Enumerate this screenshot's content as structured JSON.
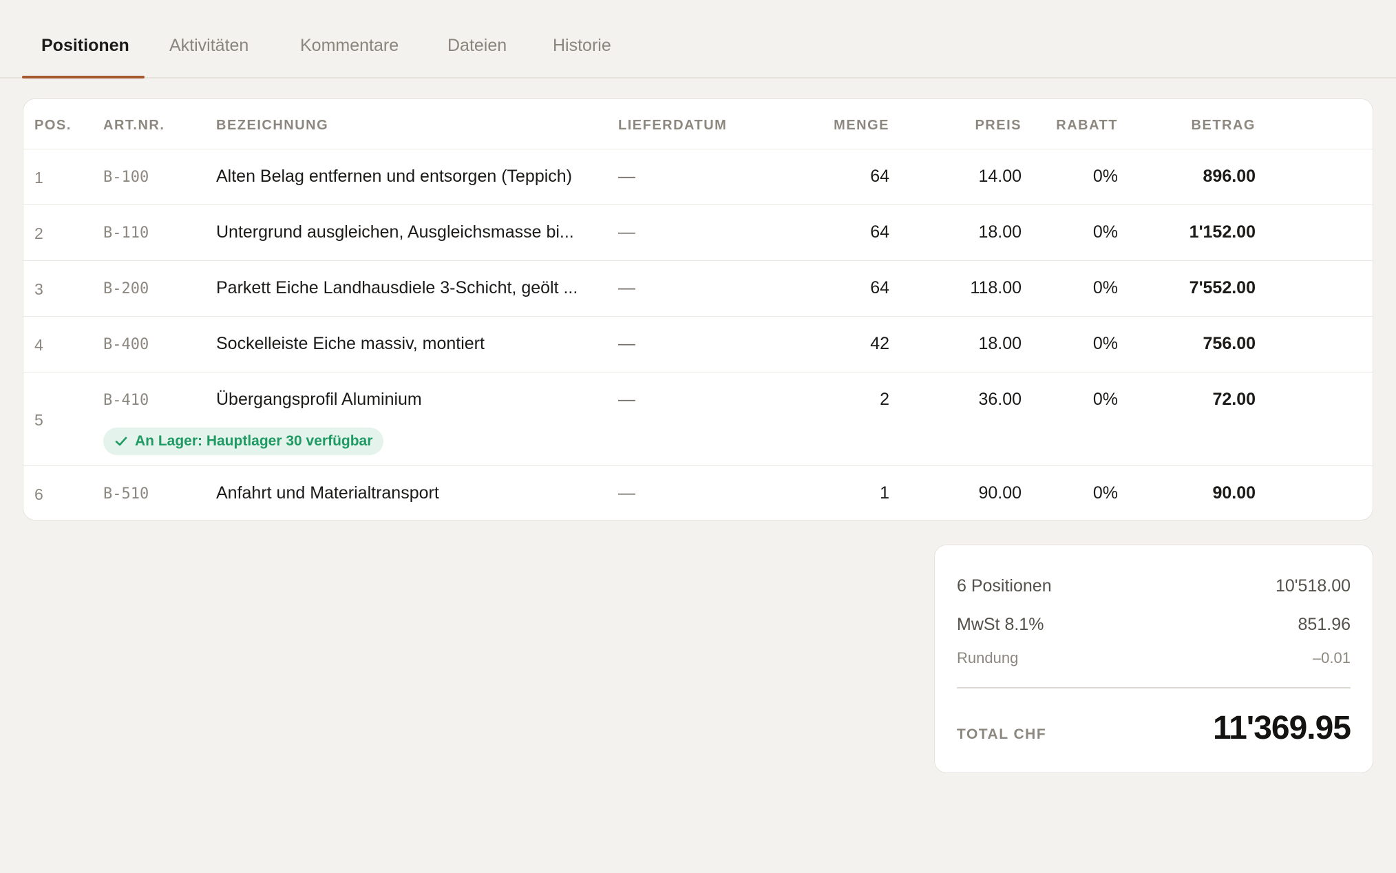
{
  "tabs": [
    {
      "label": "Positionen",
      "active": true
    },
    {
      "label": "Aktivitäten",
      "active": false
    },
    {
      "label": "Kommentare",
      "active": false
    },
    {
      "label": "Dateien",
      "active": false
    },
    {
      "label": "Historie",
      "active": false
    }
  ],
  "table": {
    "headers": {
      "pos": "POS.",
      "art": "ART.NR.",
      "desc": "BEZEICHNUNG",
      "date": "LIEFERDATUM",
      "qty": "MENGE",
      "price": "PREIS",
      "discount": "RABATT",
      "amount": "BETRAG"
    },
    "rows": [
      {
        "pos": "1",
        "art": "B-100",
        "desc": "Alten Belag entfernen und entsorgen (Teppich)",
        "date": "—",
        "qty": "64",
        "price": "14.00",
        "discount": "0%",
        "amount": "896.00"
      },
      {
        "pos": "2",
        "art": "B-110",
        "desc": "Untergrund ausgleichen, Ausgleichsmasse bi...",
        "date": "—",
        "qty": "64",
        "price": "18.00",
        "discount": "0%",
        "amount": "1'152.00"
      },
      {
        "pos": "3",
        "art": "B-200",
        "desc": "Parkett Eiche Landhausdiele 3-Schicht, geölt ...",
        "date": "—",
        "qty": "64",
        "price": "118.00",
        "discount": "0%",
        "amount": "7'552.00"
      },
      {
        "pos": "4",
        "art": "B-400",
        "desc": "Sockelleiste Eiche massiv, montiert",
        "date": "—",
        "qty": "42",
        "price": "18.00",
        "discount": "0%",
        "amount": "756.00"
      },
      {
        "pos": "5",
        "art": "B-410",
        "desc": "Übergangsprofil Aluminium",
        "date": "—",
        "qty": "2",
        "price": "36.00",
        "discount": "0%",
        "amount": "72.00",
        "badge": "An Lager: Hauptlager 30 verfügbar"
      },
      {
        "pos": "6",
        "art": "B-510",
        "desc": "Anfahrt und Materialtransport",
        "date": "—",
        "qty": "1",
        "price": "90.00",
        "discount": "0%",
        "amount": "90.00"
      }
    ]
  },
  "summary": {
    "positions_label": "6 Positionen",
    "positions_value": "10'518.00",
    "vat_label": "MwSt 8.1%",
    "vat_value": "851.96",
    "rounding_label": "Rundung",
    "rounding_value": "–0.01",
    "total_label": "TOTAL CHF",
    "total_value": "11'369.95"
  },
  "colors": {
    "accent": "#a8582f",
    "stock_green": "#1f9a63",
    "stock_bg": "#e4f3ec"
  },
  "icons": {
    "stock_badge": "check-icon"
  }
}
